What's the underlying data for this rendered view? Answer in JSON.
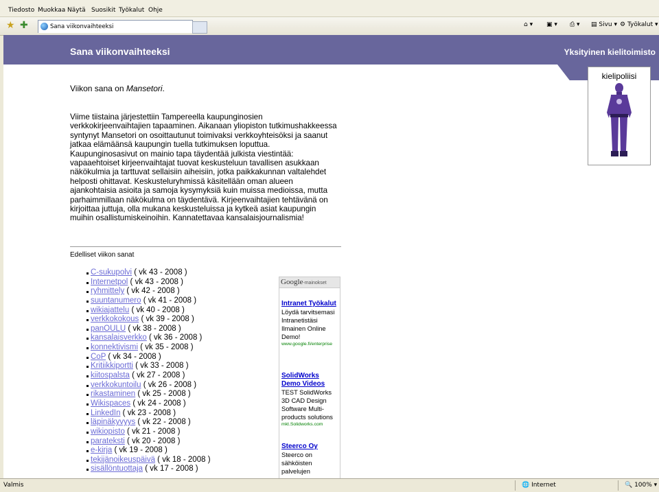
{
  "browser": {
    "menu": [
      "Tiedosto",
      "Muokkaa",
      "Näytä",
      "Suosikit",
      "Työkalut",
      "Ohje"
    ],
    "tab_title": "Sana viikonvaihteeksi",
    "page_button": "Sivu",
    "tools_button": "Työkalut",
    "status_left": "Valmis",
    "status_zone": "Internet",
    "zoom": "100%"
  },
  "page": {
    "site_title": "Sana viikonvaihteeksi",
    "org_name": "Yksityinen kielitoimisto",
    "mascot_label": "kielipoliisi",
    "word_prefix": "Viikon sana on ",
    "word": "Mansetori",
    "word_suffix": ".",
    "article": "Viime tiistaina järjestettiin Tampereella kaupunginosien verkkokirjeenvaihtajien tapaaminen. Aikanaan yliopiston tutkimushakkeessa syntynyt Mansetori on osoittautunut toimivaksi verkkoyhteisöksi ja saanut jatkaa elämäänsä kaupungin tuella tutkimuksen loputtua. Kaupunginosasivut on mainio tapa täydentää julkista viestintää: vapaaehtoiset kirjeenvaihtajat tuovat keskusteluun tavallisen asukkaan näkökulmia ja tarttuvat sellaisiin aiheisiin, jotka paikkakunnan valtalehdet helposti ohittavat. Keskusteluryhmissä käsitellään oman alueen ajankohtaisia asioita ja samoja kysymyksiä kuin muissa medioissa, mutta parhaimmillaan näkökulma on täydentävä. Kirjeenvaihtajien tehtävänä on kirjoittaa juttuja, olla mukana keskusteluissa ja kytkeä asiat kaupungin muihin osallistumiskeinoihin. Kannatettavaa kansalaisjournalismia!",
    "previous_heading": "Edelliset viikon sanat",
    "previous_words": [
      {
        "word": "C-sukupolvi",
        "week": " ( vk 43 - 2008 )"
      },
      {
        "word": "Internetpol",
        "week": " ( vk 43 - 2008 )"
      },
      {
        "word": "ryhmittely",
        "week": " ( vk 42 - 2008 )"
      },
      {
        "word": "suuntanumero",
        "week": " ( vk 41 - 2008 )"
      },
      {
        "word": "wikiajattelu",
        "week": " ( vk 40 - 2008 )"
      },
      {
        "word": "verkkokokous",
        "week": " ( vk 39 - 2008 )"
      },
      {
        "word": "panOULU",
        "week": " ( vk 38 - 2008 )"
      },
      {
        "word": "kansalaisverkko",
        "week": " ( vk 36 - 2008 )"
      },
      {
        "word": "konnektivismi",
        "week": " ( vk 35 - 2008 )"
      },
      {
        "word": "CoP",
        "week": " ( vk 34 - 2008 )"
      },
      {
        "word": "Kritiikkiportti",
        "week": " ( vk 33 - 2008 )"
      },
      {
        "word": "kiitospalsta",
        "week": " ( vk 27 - 2008 )"
      },
      {
        "word": "verkkokuntoilu",
        "week": " ( vk 26 - 2008 )"
      },
      {
        "word": "rikastaminen",
        "week": " ( vk 25 - 2008 )"
      },
      {
        "word": "Wikispaces",
        "week": " ( vk 24 - 2008 )"
      },
      {
        "word": "LinkedIn",
        "week": " ( vk 23 - 2008 )"
      },
      {
        "word": "läpinäkyvyys",
        "week": " ( vk 22 - 2008 )"
      },
      {
        "word": "wikiopisto",
        "week": " ( vk 21 - 2008 )"
      },
      {
        "word": "parateksti",
        "week": " ( vk 20 - 2008 )"
      },
      {
        "word": "e-kirja",
        "week": " ( vk 19 - 2008 )"
      },
      {
        "word": "tekijänoikeuspäivä",
        "week": " ( vk 18 - 2008 )"
      },
      {
        "word": "sisällöntuottaja",
        "week": " ( vk 17 - 2008 )"
      }
    ]
  },
  "ads": {
    "header_brand": "Google",
    "header_label": "-mainokset",
    "items": [
      {
        "title": "Intranet Työkalut",
        "body": "Löydä tarvitsemasi Intranetistäsi Ilmainen Online Demo!",
        "url": "www.google.fi/enterprise"
      },
      {
        "title": "SolidWorks Demo Videos",
        "body": "TEST SolidWorks 3D CAD Design Software Multi-products solutions",
        "url": "mkt.Solidworks.com"
      },
      {
        "title": "Steerco Oy",
        "body": "Steerco on sähköisten palvelujen",
        "url": ""
      }
    ]
  },
  "colors": {
    "header_bg": "#68669c",
    "link": "#6b6bd6",
    "ad_title": "#0000cc",
    "ad_url": "#008000",
    "mascot_suit": "#5a3a9a"
  }
}
